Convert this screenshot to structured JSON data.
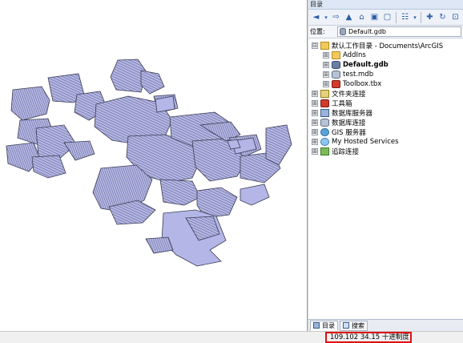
{
  "catalog": {
    "title": "目录",
    "location_label": "位置:",
    "location_value": "Default.gdb",
    "toolbar_icons": [
      "back-arrow-icon",
      "dropdown-arrow-icon",
      "forward-arrow-icon",
      "folder-up-icon",
      "home-icon",
      "connect-folder-icon",
      "disconnect-folder-icon",
      "view-toggle-icon",
      "view-dropdown-icon",
      "new-folder-icon",
      "refresh-icon",
      "options-icon"
    ],
    "tree": [
      {
        "label": "默认工作目录 - Documents\\ArcGIS",
        "expander": "⊟",
        "icon": "home-folder-icon",
        "indent": 0,
        "bold": false
      },
      {
        "label": "AddIns",
        "expander": "⊞",
        "icon": "folder-icon",
        "indent": 1,
        "bold": false
      },
      {
        "label": "Default.gdb",
        "expander": "⊞",
        "icon": "geodatabase-icon",
        "indent": 1,
        "bold": true
      },
      {
        "label": "test.mdb",
        "expander": "⊞",
        "icon": "personal-geodatabase-icon",
        "indent": 1,
        "bold": false
      },
      {
        "label": "Toolbox.tbx",
        "expander": "⊞",
        "icon": "toolbox-icon",
        "indent": 1,
        "bold": false
      },
      {
        "label": "文件夹连接",
        "expander": "⊞",
        "icon": "folder-connection-icon",
        "indent": 0,
        "bold": false
      },
      {
        "label": "工具箱",
        "expander": "⊞",
        "icon": "toolbox-icon",
        "indent": 0,
        "bold": false
      },
      {
        "label": "数据库服务器",
        "expander": "⊞",
        "icon": "database-server-icon",
        "indent": 0,
        "bold": false
      },
      {
        "label": "数据库连接",
        "expander": "⊞",
        "icon": "database-connection-icon",
        "indent": 0,
        "bold": false
      },
      {
        "label": "GIS 服务器",
        "expander": "⊞",
        "icon": "gis-server-icon",
        "indent": 0,
        "bold": false
      },
      {
        "label": "My Hosted Services",
        "expander": "⊞",
        "icon": "hosted-services-icon",
        "indent": 0,
        "bold": false
      },
      {
        "label": "追踪连接",
        "expander": "⊞",
        "icon": "tracking-connection-icon",
        "indent": 0,
        "bold": false
      }
    ],
    "tabs": [
      {
        "label": "目录",
        "icon": "catalog-icon",
        "active": true
      },
      {
        "label": "搜索",
        "icon": "search-icon",
        "active": false
      }
    ]
  },
  "status": {
    "coordinates": "109.102  34.15 十进制度"
  },
  "colors": {
    "map_fill": "#b4b6e8",
    "map_stroke": "#3a3c52",
    "highlight_border": "#e01010"
  }
}
